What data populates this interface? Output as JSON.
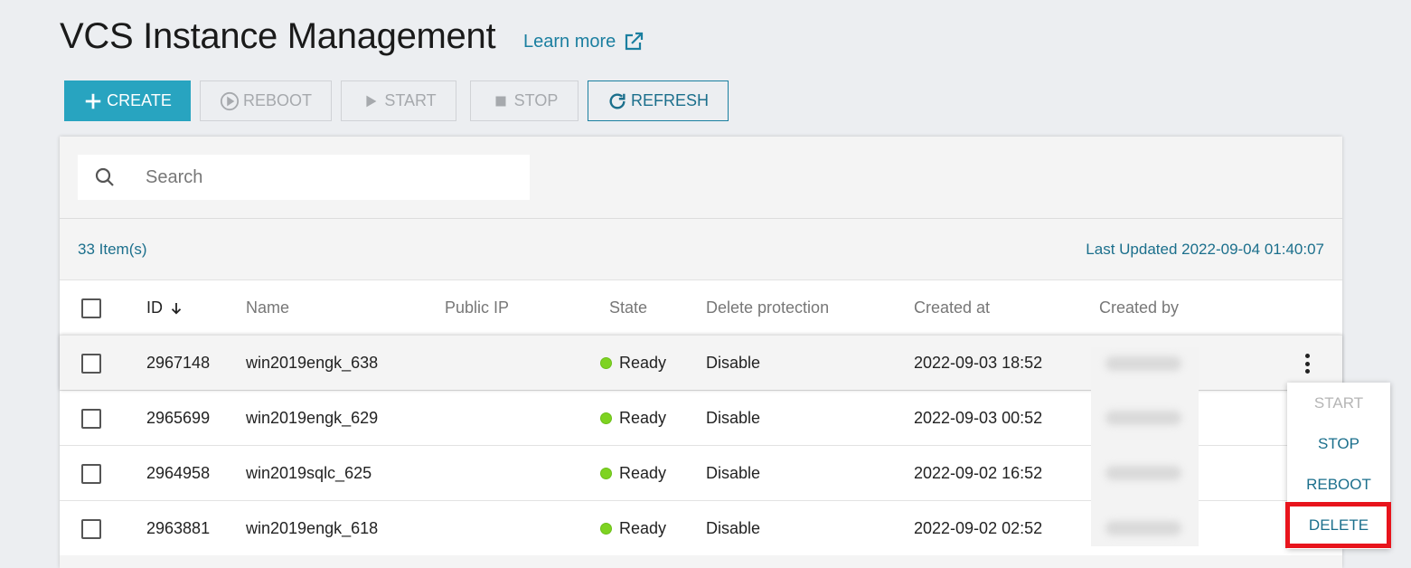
{
  "header": {
    "title": "VCS Instance Management",
    "learn_more": "Learn more"
  },
  "toolbar": {
    "create": "CREATE",
    "reboot": "REBOOT",
    "start": "START",
    "stop": "STOP",
    "refresh": "REFRESH"
  },
  "search": {
    "placeholder": "Search",
    "value": ""
  },
  "summary": {
    "item_count": "33 Item(s)",
    "last_updated": "Last Updated 2022-09-04 01:40:07"
  },
  "table": {
    "columns": [
      "ID",
      "Name",
      "Public IP",
      "State",
      "Delete protection",
      "Created at",
      "Created by"
    ],
    "rows": [
      {
        "id": "2967148",
        "name": "win2019engk_638",
        "public_ip": "",
        "state": "Ready",
        "delete_protection": "Disable",
        "created_at": "2022-09-03 18:52"
      },
      {
        "id": "2965699",
        "name": "win2019engk_629",
        "public_ip": "",
        "state": "Ready",
        "delete_protection": "Disable",
        "created_at": "2022-09-03 00:52"
      },
      {
        "id": "2964958",
        "name": "win2019sqlc_625",
        "public_ip": "",
        "state": "Ready",
        "delete_protection": "Disable",
        "created_at": "2022-09-02 16:52"
      },
      {
        "id": "2963881",
        "name": "win2019engk_618",
        "public_ip": "",
        "state": "Ready",
        "delete_protection": "Disable",
        "created_at": "2022-09-02 02:52"
      }
    ]
  },
  "context_menu": {
    "items": [
      "START",
      "STOP",
      "REBOOT",
      "DELETE"
    ],
    "disabled": [
      "START"
    ],
    "highlighted": "DELETE"
  },
  "colors": {
    "accent": "#28a4c0",
    "link": "#1b6f8c",
    "ready": "#7ed321",
    "highlight": "#e8141c"
  }
}
